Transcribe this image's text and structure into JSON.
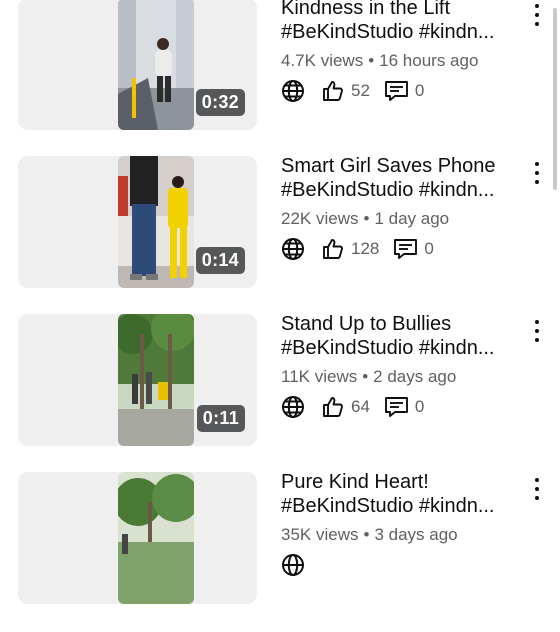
{
  "videos": [
    {
      "title_line1": "Kindness in the Lift",
      "title_line2": "#BeKindStudio #kindn...",
      "views": "4.7K views",
      "age": "16 hours ago",
      "likes": "52",
      "comments": "0",
      "duration": "0:32"
    },
    {
      "title_line1": "Smart Girl Saves Phone",
      "title_line2": "#BeKindStudio #kindn...",
      "views": "22K views",
      "age": "1 day ago",
      "likes": "128",
      "comments": "0",
      "duration": "0:14"
    },
    {
      "title_line1": "Stand Up to Bullies",
      "title_line2": "#BeKindStudio #kindn...",
      "views": "11K views",
      "age": "2 days ago",
      "likes": "64",
      "comments": "0",
      "duration": "0:11"
    },
    {
      "title_line1": "Pure Kind Heart!",
      "title_line2": "#BeKindStudio #kindn...",
      "views": "35K views",
      "age": "3 days ago",
      "likes": "",
      "comments": "",
      "duration": ""
    }
  ],
  "icons": {
    "visibility": "globe-icon",
    "likes": "thumbs-up-icon",
    "comments": "comment-icon",
    "menu": "more-vertical-icon"
  },
  "colors": {
    "text": "#0f0f0f",
    "meta": "#606060",
    "card": "#efefef",
    "badge": "#555759"
  }
}
